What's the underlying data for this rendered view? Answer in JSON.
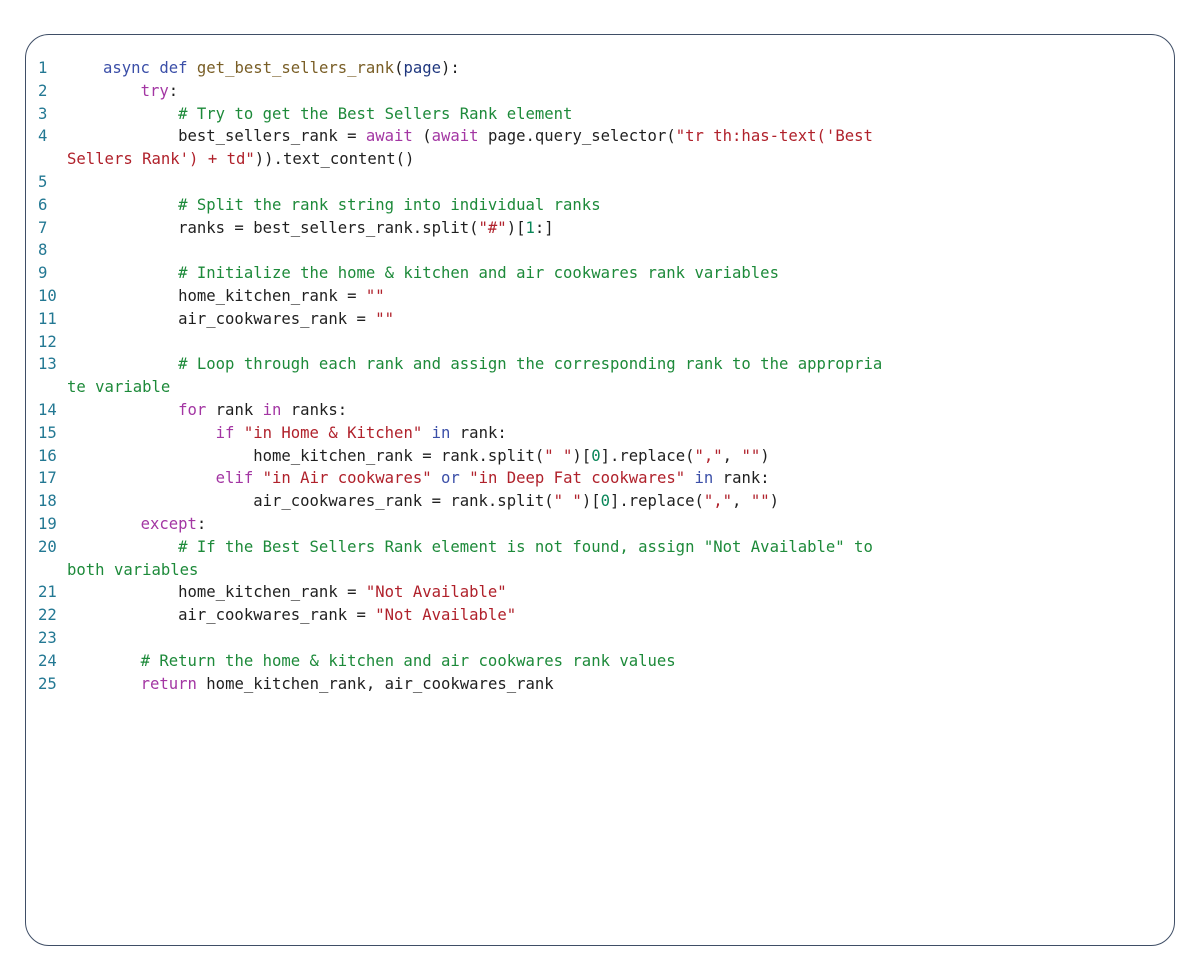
{
  "colors": {
    "border": "#3f4e66",
    "line_number": "#237893",
    "keyword": "#3b4fa8",
    "control": "#a336a3",
    "function": "#795e26",
    "string": "#b0212b",
    "comment": "#1d8a3a",
    "number": "#098658",
    "text": "#1f1f1f"
  },
  "code": {
    "language": "python",
    "lines": [
      {
        "n": "1",
        "segments": [
          [
            [
              "kw",
              "async"
            ],
            [
              "plain",
              " "
            ],
            [
              "kw",
              "def"
            ],
            [
              "plain",
              " "
            ],
            [
              "fn",
              "get_best_sellers_rank"
            ],
            [
              "plain",
              "("
            ],
            [
              "param",
              "page"
            ],
            [
              "plain",
              "):"
            ]
          ]
        ]
      },
      {
        "n": "2",
        "segments": [
          [
            [
              "plain",
              "    "
            ],
            [
              "ctl",
              "try"
            ],
            [
              "plain",
              ":"
            ]
          ]
        ]
      },
      {
        "n": "3",
        "segments": [
          [
            [
              "plain",
              "        "
            ],
            [
              "com",
              "# Try to get the Best Sellers Rank element"
            ]
          ]
        ]
      },
      {
        "n": "4",
        "segments": [
          [
            [
              "plain",
              "        best_sellers_rank = "
            ],
            [
              "ctl",
              "await"
            ],
            [
              "plain",
              " ("
            ],
            [
              "ctl",
              "await"
            ],
            [
              "plain",
              " page.query_selector("
            ],
            [
              "str",
              "\"tr th:has-text('Best"
            ]
          ],
          [
            [
              "str",
              "Sellers Rank') + td\""
            ],
            [
              "plain",
              "))."
            ],
            [
              "plain",
              "text_content()"
            ]
          ]
        ]
      },
      {
        "n": "5",
        "segments": [
          [
            [
              "plain",
              ""
            ]
          ]
        ]
      },
      {
        "n": "6",
        "segments": [
          [
            [
              "plain",
              "        "
            ],
            [
              "com",
              "# Split the rank string into individual ranks"
            ]
          ]
        ]
      },
      {
        "n": "7",
        "segments": [
          [
            [
              "plain",
              "        ranks = best_sellers_rank.split("
            ],
            [
              "str",
              "\"#\""
            ],
            [
              "plain",
              ")["
            ],
            [
              "num",
              "1"
            ],
            [
              "plain",
              ":]"
            ]
          ]
        ]
      },
      {
        "n": "8",
        "segments": [
          [
            [
              "plain",
              ""
            ]
          ]
        ]
      },
      {
        "n": "9",
        "segments": [
          [
            [
              "plain",
              "        "
            ],
            [
              "com",
              "# Initialize the home & kitchen and air cookwares rank variables"
            ]
          ]
        ]
      },
      {
        "n": "10",
        "segments": [
          [
            [
              "plain",
              "        home_kitchen_rank = "
            ],
            [
              "str",
              "\"\""
            ]
          ]
        ]
      },
      {
        "n": "11",
        "segments": [
          [
            [
              "plain",
              "        air_cookwares_rank = "
            ],
            [
              "str",
              "\"\""
            ]
          ]
        ]
      },
      {
        "n": "12",
        "segments": [
          [
            [
              "plain",
              ""
            ]
          ]
        ]
      },
      {
        "n": "13",
        "segments": [
          [
            [
              "plain",
              "        "
            ],
            [
              "com",
              "# Loop through each rank and assign the corresponding rank to the appropria"
            ]
          ],
          [
            [
              "com",
              "te variable"
            ]
          ]
        ]
      },
      {
        "n": "14",
        "segments": [
          [
            [
              "plain",
              "        "
            ],
            [
              "ctl",
              "for"
            ],
            [
              "plain",
              " rank "
            ],
            [
              "ctl",
              "in"
            ],
            [
              "plain",
              " ranks:"
            ]
          ]
        ]
      },
      {
        "n": "15",
        "segments": [
          [
            [
              "plain",
              "            "
            ],
            [
              "ctl",
              "if"
            ],
            [
              "plain",
              " "
            ],
            [
              "str",
              "\"in Home & Kitchen\""
            ],
            [
              "plain",
              " "
            ],
            [
              "kw",
              "in"
            ],
            [
              "plain",
              " rank:"
            ]
          ]
        ]
      },
      {
        "n": "16",
        "segments": [
          [
            [
              "plain",
              "                home_kitchen_rank = rank.split("
            ],
            [
              "str",
              "\" \""
            ],
            [
              "plain",
              ")["
            ],
            [
              "num",
              "0"
            ],
            [
              "plain",
              "].replace("
            ],
            [
              "str",
              "\",\""
            ],
            [
              "plain",
              ", "
            ],
            [
              "str",
              "\"\""
            ],
            [
              "plain",
              ")"
            ]
          ]
        ]
      },
      {
        "n": "17",
        "segments": [
          [
            [
              "plain",
              "            "
            ],
            [
              "ctl",
              "elif"
            ],
            [
              "plain",
              " "
            ],
            [
              "str",
              "\"in Air cookwares\""
            ],
            [
              "plain",
              " "
            ],
            [
              "kw",
              "or"
            ],
            [
              "plain",
              " "
            ],
            [
              "str",
              "\"in Deep Fat cookwares\""
            ],
            [
              "plain",
              " "
            ],
            [
              "kw",
              "in"
            ],
            [
              "plain",
              " rank:"
            ]
          ]
        ]
      },
      {
        "n": "18",
        "segments": [
          [
            [
              "plain",
              "                air_cookwares_rank = rank.split("
            ],
            [
              "str",
              "\" \""
            ],
            [
              "plain",
              ")["
            ],
            [
              "num",
              "0"
            ],
            [
              "plain",
              "].replace("
            ],
            [
              "str",
              "\",\""
            ],
            [
              "plain",
              ", "
            ],
            [
              "str",
              "\"\""
            ],
            [
              "plain",
              ")"
            ]
          ]
        ]
      },
      {
        "n": "19",
        "segments": [
          [
            [
              "plain",
              "    "
            ],
            [
              "ctl",
              "except"
            ],
            [
              "plain",
              ":"
            ]
          ]
        ]
      },
      {
        "n": "20",
        "segments": [
          [
            [
              "plain",
              "        "
            ],
            [
              "com",
              "# If the Best Sellers Rank element is not found, assign \"Not Available\" to"
            ]
          ],
          [
            [
              "com",
              "both variables"
            ]
          ]
        ]
      },
      {
        "n": "21",
        "segments": [
          [
            [
              "plain",
              "        home_kitchen_rank = "
            ],
            [
              "str",
              "\"Not Available\""
            ]
          ]
        ]
      },
      {
        "n": "22",
        "segments": [
          [
            [
              "plain",
              "        air_cookwares_rank = "
            ],
            [
              "str",
              "\"Not Available\""
            ]
          ]
        ]
      },
      {
        "n": "23",
        "segments": [
          [
            [
              "plain",
              ""
            ]
          ]
        ]
      },
      {
        "n": "24",
        "segments": [
          [
            [
              "plain",
              "    "
            ],
            [
              "com",
              "# Return the home & kitchen and air cookwares rank values"
            ]
          ]
        ]
      },
      {
        "n": "25",
        "segments": [
          [
            [
              "plain",
              "    "
            ],
            [
              "ctl",
              "return"
            ],
            [
              "plain",
              " home_kitchen_rank, air_cookwares_rank"
            ]
          ]
        ]
      }
    ]
  }
}
